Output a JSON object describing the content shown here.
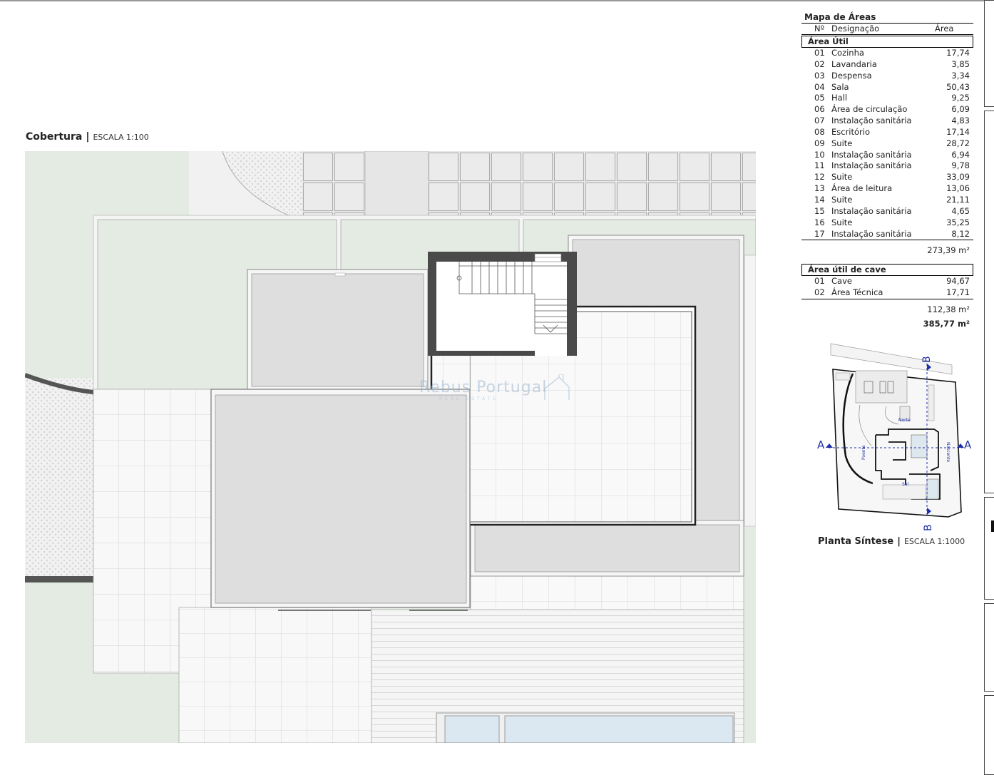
{
  "plan": {
    "title": "Cobertura",
    "separator": "|",
    "scale": "ESCALA 1:100"
  },
  "watermark": {
    "text": "Rebus Portugal",
    "subtext": "REAL ESTATE"
  },
  "areas_table": {
    "title": "Mapa de Áreas",
    "headers": {
      "no": "Nº",
      "designation": "Designação",
      "area": "Área"
    },
    "sections": [
      {
        "name": "Área Útil",
        "rows": [
          {
            "no": "01",
            "designation": "Cozinha",
            "area": "17,74"
          },
          {
            "no": "02",
            "designation": "Lavandaria",
            "area": "3,85"
          },
          {
            "no": "03",
            "designation": "Despensa",
            "area": "3,34"
          },
          {
            "no": "04",
            "designation": "Sala",
            "area": "50,43"
          },
          {
            "no": "05",
            "designation": "Hall",
            "area": "9,25"
          },
          {
            "no": "06",
            "designation": "Área de circulação",
            "area": "6,09"
          },
          {
            "no": "07",
            "designation": "Instalação sanitária",
            "area": "4,83"
          },
          {
            "no": "08",
            "designation": "Escritório",
            "area": "17,14"
          },
          {
            "no": "09",
            "designation": "Suite",
            "area": "28,72"
          },
          {
            "no": "10",
            "designation": "Instalação sanitária",
            "area": "6,94"
          },
          {
            "no": "11",
            "designation": "Instalação sanitária",
            "area": "9,78"
          },
          {
            "no": "12",
            "designation": "Suite",
            "area": "33,09"
          },
          {
            "no": "13",
            "designation": "Área de leitura",
            "area": "13,06"
          },
          {
            "no": "14",
            "designation": "Suite",
            "area": "21,11"
          },
          {
            "no": "15",
            "designation": "Instalação sanitária",
            "area": "4,65"
          },
          {
            "no": "16",
            "designation": "Suite",
            "area": "35,25"
          },
          {
            "no": "17",
            "designation": "Instalação sanitária",
            "area": "8,12"
          }
        ],
        "subtotal": "273,39 m²"
      },
      {
        "name": "Área útil de cave",
        "rows": [
          {
            "no": "01",
            "designation": "Cave",
            "area": "94,67"
          },
          {
            "no": "02",
            "designation": "Área Técnica",
            "area": "17,71"
          }
        ],
        "subtotal": "112,38 m²"
      }
    ],
    "total": "385,77 m²"
  },
  "synthesis": {
    "title": "Planta Síntese",
    "separator": "|",
    "scale": "ESCALA 1:1000",
    "section_marks": {
      "a": "A",
      "b": "B"
    },
    "labels": {
      "norte": "Norte",
      "poente": "Poente",
      "nascente": "Nascente",
      "sul": "Sul"
    }
  },
  "colors": {
    "lawn": "#e3ebe2",
    "roof": "#dedede",
    "stair_wall": "#4a4a4a",
    "tile_line": "#c8c8c8",
    "section_mark": "#1f2fa8",
    "pool": "#dbe8f2"
  }
}
